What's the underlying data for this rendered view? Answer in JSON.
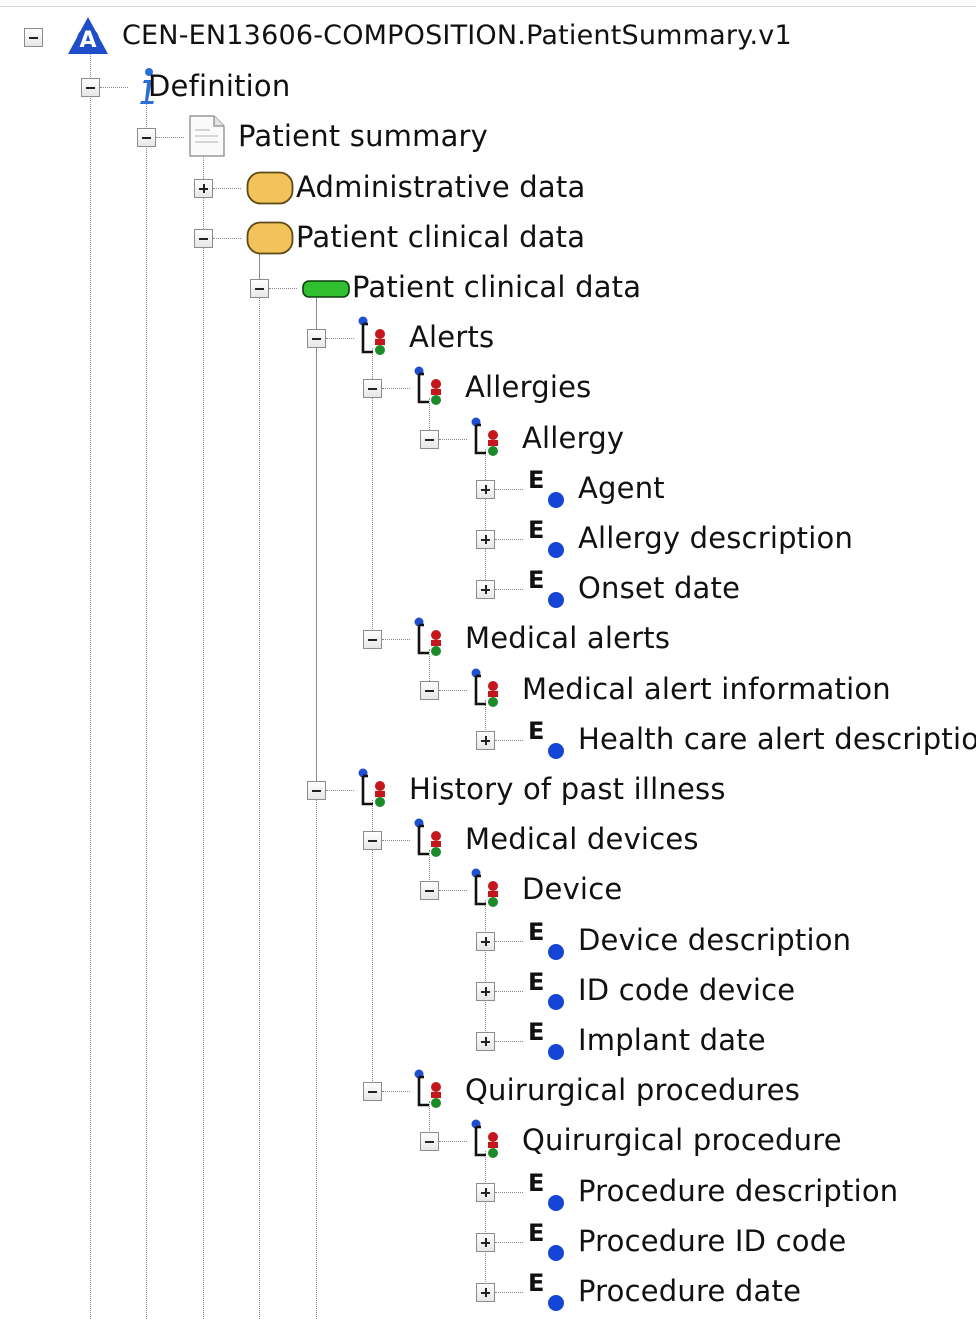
{
  "tree": {
    "nodes": [
      {
        "label": "CEN-EN13606-COMPOSITION.PatientSummary.v1",
        "level": 0,
        "icon": "archetype-a-icon",
        "expanded": true
      },
      {
        "label": "Definition",
        "level": 1,
        "icon": "info-icon",
        "expanded": true
      },
      {
        "label": "Patient summary",
        "level": 2,
        "icon": "document-icon",
        "expanded": true
      },
      {
        "label": "Administrative data",
        "level": 3,
        "icon": "section-icon",
        "expanded": false
      },
      {
        "label": "Patient clinical data",
        "level": 3,
        "icon": "section-icon",
        "expanded": true
      },
      {
        "label": "Patient clinical data",
        "level": 4,
        "icon": "entry-icon",
        "expanded": true
      },
      {
        "label": "Alerts",
        "level": 5,
        "icon": "cluster-icon",
        "expanded": true
      },
      {
        "label": "Allergies",
        "level": 6,
        "icon": "cluster-icon",
        "expanded": true
      },
      {
        "label": "Allergy",
        "level": 7,
        "icon": "cluster-icon",
        "expanded": true
      },
      {
        "label": "Agent",
        "level": 8,
        "icon": "element-icon",
        "expanded": false
      },
      {
        "label": "Allergy description",
        "level": 8,
        "icon": "element-icon",
        "expanded": false
      },
      {
        "label": "Onset date",
        "level": 8,
        "icon": "element-icon",
        "expanded": false
      },
      {
        "label": "Medical alerts",
        "level": 6,
        "icon": "cluster-icon",
        "expanded": true
      },
      {
        "label": "Medical alert information",
        "level": 7,
        "icon": "cluster-icon",
        "expanded": true
      },
      {
        "label": "Health care alert description",
        "level": 8,
        "icon": "element-icon",
        "expanded": false
      },
      {
        "label": "History of past illness",
        "level": 5,
        "icon": "cluster-icon",
        "expanded": true
      },
      {
        "label": "Medical devices",
        "level": 6,
        "icon": "cluster-icon",
        "expanded": true
      },
      {
        "label": "Device",
        "level": 7,
        "icon": "cluster-icon",
        "expanded": true
      },
      {
        "label": "Device description",
        "level": 8,
        "icon": "element-icon",
        "expanded": false
      },
      {
        "label": "ID code device",
        "level": 8,
        "icon": "element-icon",
        "expanded": false
      },
      {
        "label": "Implant date",
        "level": 8,
        "icon": "element-icon",
        "expanded": false
      },
      {
        "label": "Quirurgical procedures",
        "level": 6,
        "icon": "cluster-icon",
        "expanded": true
      },
      {
        "label": "Quirurgical procedure",
        "level": 7,
        "icon": "cluster-icon",
        "expanded": true
      },
      {
        "label": "Procedure description",
        "level": 8,
        "icon": "element-icon",
        "expanded": false
      },
      {
        "label": "Procedure ID code",
        "level": 8,
        "icon": "element-icon",
        "expanded": false
      },
      {
        "label": "Procedure date",
        "level": 8,
        "icon": "element-icon",
        "expanded": false
      }
    ]
  },
  "colors": {
    "archetype": "#1e4fc9",
    "info": "#2b6fd6",
    "section_fill": "#f2c35a",
    "entry_fill": "#2fbf2f",
    "cluster_blue": "#1d4fd0",
    "cluster_red": "#c4161c",
    "cluster_green": "#1a8a2a",
    "element_blue": "#1545d6"
  }
}
